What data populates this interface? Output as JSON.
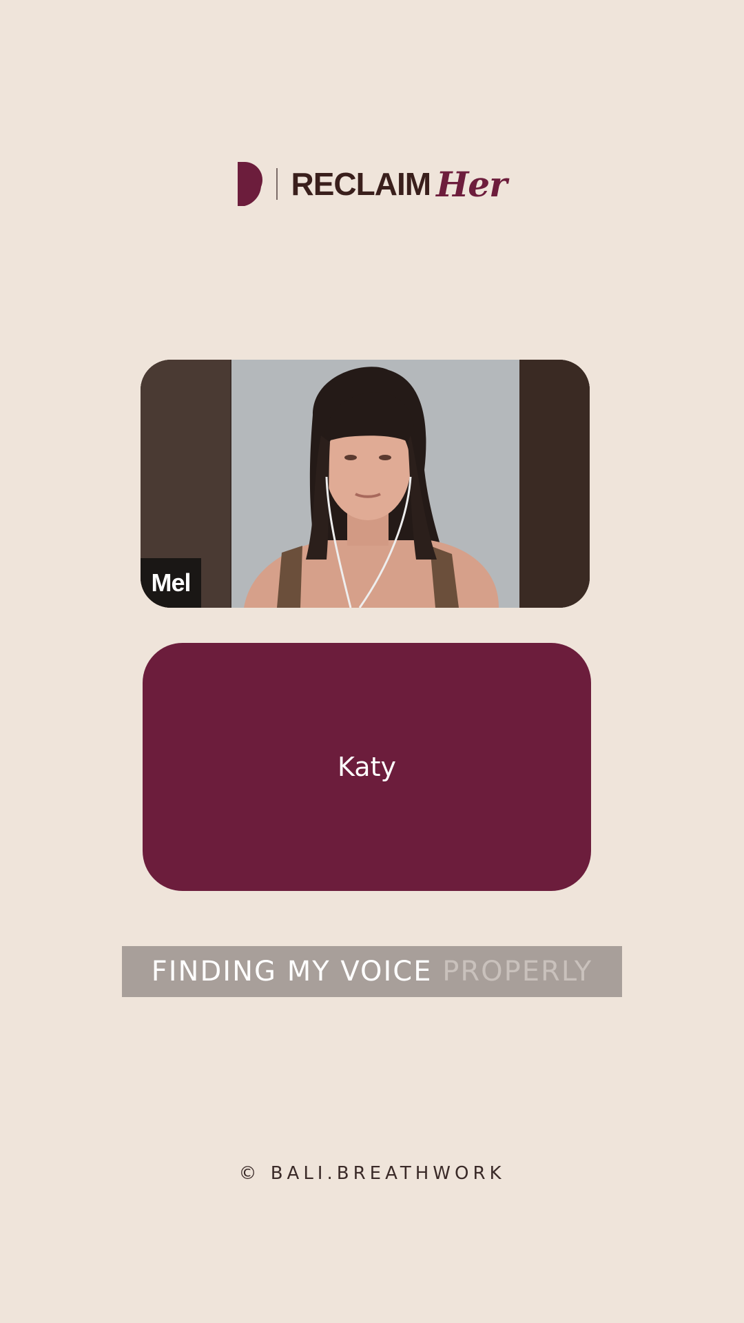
{
  "brand": {
    "wordmark": "RECLAIM",
    "script": "Her",
    "accent_color": "#6c1d3c",
    "text_color": "#3a1f1c",
    "logo_icon": "half-moon-logo-icon"
  },
  "participants": [
    {
      "name": "Mel",
      "video": "on"
    },
    {
      "name": "Katy",
      "video": "off",
      "tile_color": "#6c1d3c"
    }
  ],
  "caption": {
    "spoken": "FINDING MY VOICE",
    "upcoming": "PROPERLY"
  },
  "footer": {
    "text": "© BALI.BREATHWORK"
  }
}
